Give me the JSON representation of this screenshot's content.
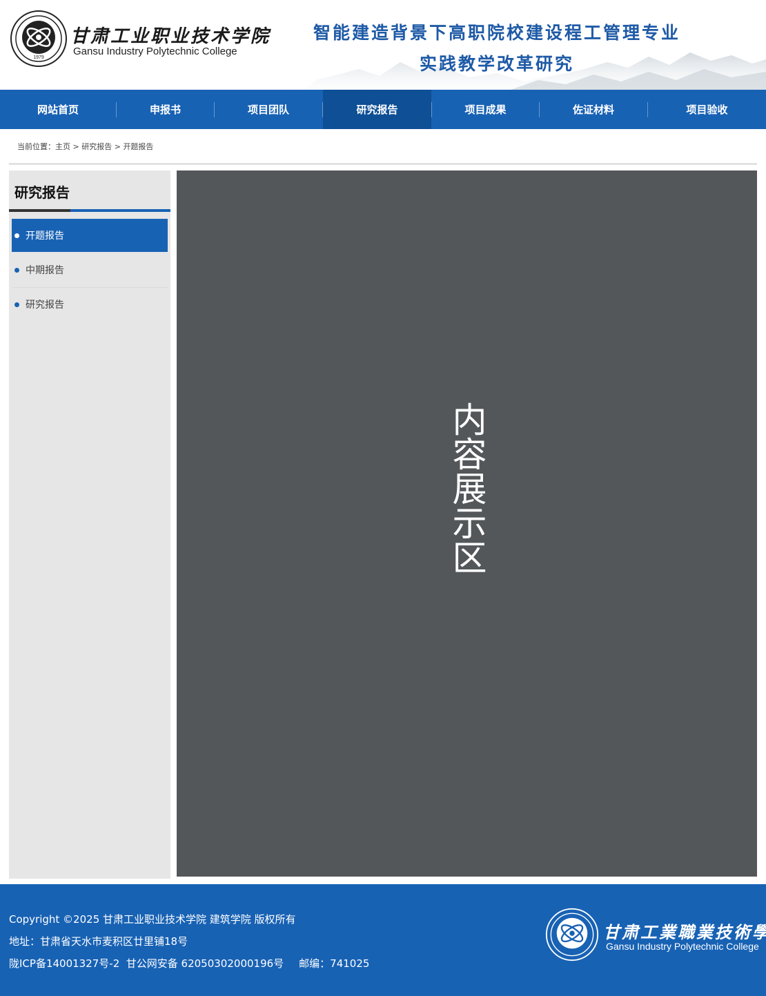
{
  "header": {
    "logo_cn": "甘肃工业职业技术学院",
    "logo_en": "Gansu Industry Polytechnic College",
    "emblem_year": "1979",
    "title_line1": "智能建造背景下高职院校建设程工管理专业",
    "title_line2": "实践教学改革研究"
  },
  "nav": {
    "items": [
      {
        "label": "网站首页",
        "active": false
      },
      {
        "label": "申报书",
        "active": false
      },
      {
        "label": "项目团队",
        "active": false
      },
      {
        "label": "研究报告",
        "active": true
      },
      {
        "label": "项目成果",
        "active": false
      },
      {
        "label": "佐证材料",
        "active": false
      },
      {
        "label": "项目验收",
        "active": false
      }
    ]
  },
  "breadcrumb": {
    "prefix": "当前位置：",
    "items": [
      "主页",
      "研究报告",
      "开题报告"
    ],
    "separator": " > "
  },
  "sidebar": {
    "title": "研究报告",
    "items": [
      {
        "label": "开题报告",
        "active": true
      },
      {
        "label": "中期报告",
        "active": false
      },
      {
        "label": "研究报告",
        "active": false
      }
    ]
  },
  "content": {
    "placeholder": "内容展示区"
  },
  "footer": {
    "copyright": "Copyright ©2025   甘肃工业职业技术学院 建筑学院 版权所有",
    "address": "地址：甘肃省天水市麦积区廿里铺18号",
    "icp": "陇ICP备14001327号-2  甘公网安备 62050302000196号",
    "postcode": "邮编：741025",
    "logo_cn": "甘肃工業職業技術學院",
    "logo_en": "Gansu Industry Polytechnic College"
  },
  "colors": {
    "primary": "#1862b4",
    "primary_dark": "#0e4f96",
    "title_blue": "#1e5aa6",
    "content_bg": "#53575a",
    "sidebar_bg": "#e6e6e6"
  }
}
